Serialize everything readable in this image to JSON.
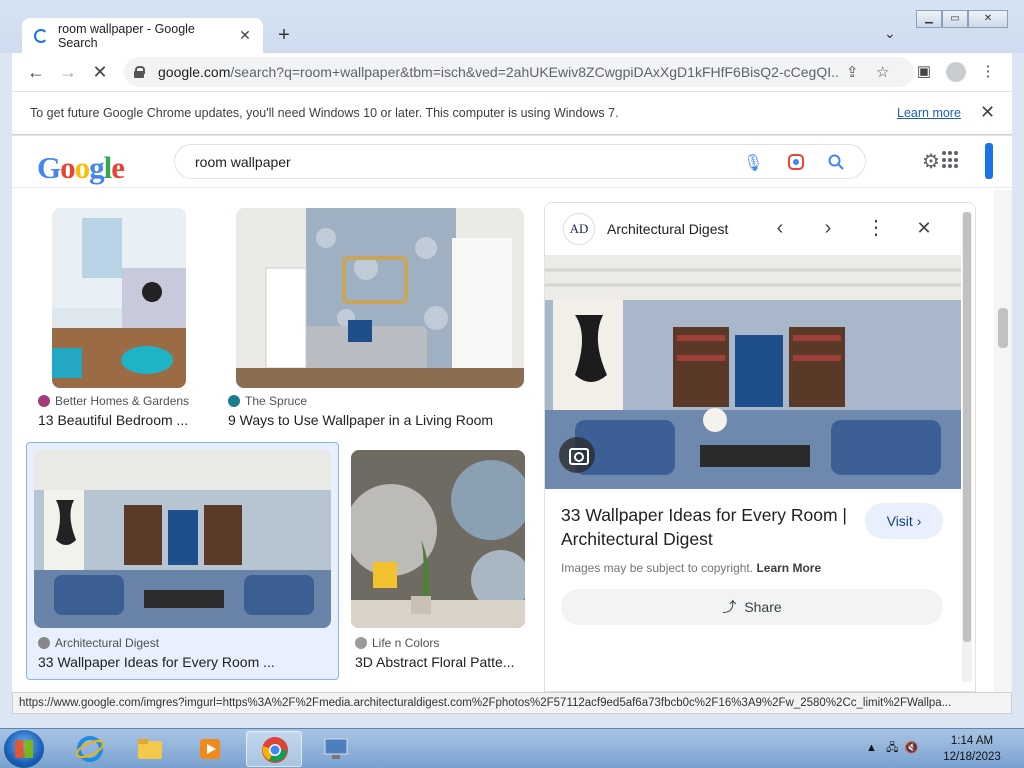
{
  "browser": {
    "tab_title": "room wallpaper - Google Search",
    "tab_close": "✕",
    "new_tab": "+",
    "url_host": "google.com",
    "url_path": "/search?q=room+wallpaper&tbm=isch&ved=2ahUKEwiv8ZCwgpiDAxXgD1kFHfF6BisQ2-cCegQI...",
    "infobar_text": "To get future Google Chrome updates, you'll need Windows 10 or later. This computer is using Windows 7.",
    "infobar_link": "Learn more",
    "status_url": "https://www.google.com/imgres?imgurl=https%3A%2F%2Fmedia.architecturaldigest.com%2Fphotos%2F57112acf9ed5af6a73fbcb0c%2F16%3A9%2Fw_2580%2Cc_limit%2FWallpa..."
  },
  "google": {
    "logo_letters": [
      "G",
      "o",
      "o",
      "g",
      "l",
      "e"
    ],
    "query": "room wallpaper"
  },
  "results": [
    {
      "source": "Better Homes & Gardens",
      "title": "13 Beautiful Bedroom ...",
      "icon_color": "#a33c7e"
    },
    {
      "source": "The Spruce",
      "title": "9 Ways to Use Wallpaper in a Living Room",
      "icon_color": "#1c7c8c"
    },
    {
      "source": "Architectural Digest",
      "title": "33 Wallpaper Ideas for Every Room ...",
      "icon_color": "#888888"
    },
    {
      "source": "Life n Colors",
      "title": "3D Abstract Floral Patte...",
      "icon_color": "#9a9a9a"
    }
  ],
  "panel": {
    "logo_text": "AD",
    "source": "Architectural Digest",
    "title": "33 Wallpaper Ideas for Every Room | Architectural Digest",
    "visit_label": "Visit",
    "copyright_text": "Images may be subject to copyright.",
    "copyright_link": "Learn More",
    "share_label": "Share"
  },
  "taskbar": {
    "time": "1:14 AM",
    "date": "12/18/2023"
  }
}
